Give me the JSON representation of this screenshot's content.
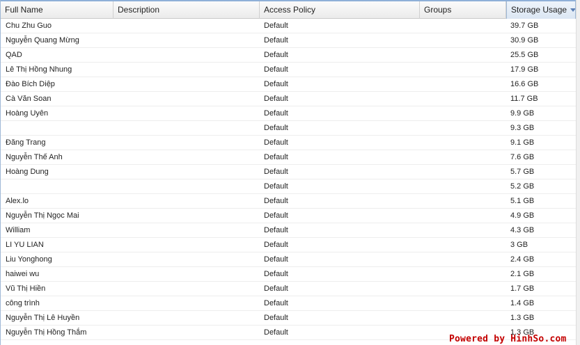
{
  "columns": {
    "full_name": "Full Name",
    "description": "Description",
    "access_policy": "Access Policy",
    "groups": "Groups",
    "storage_usage": "Storage Usage"
  },
  "sort": {
    "column": "storage_usage",
    "direction": "descending",
    "icon": "chevron-down-icon"
  },
  "rows": [
    {
      "name": "Chu Zhu Guo",
      "description": "",
      "policy": "Default",
      "groups": "",
      "usage": "39.7 GB"
    },
    {
      "name": "Nguyễn Quang Mừng",
      "description": "",
      "policy": "Default",
      "groups": "",
      "usage": "30.9 GB"
    },
    {
      "name": "QAD",
      "description": "",
      "policy": "Default",
      "groups": "",
      "usage": "25.5 GB"
    },
    {
      "name": "Lê Thị Hồng Nhung",
      "description": "",
      "policy": "Default",
      "groups": "",
      "usage": "17.9 GB"
    },
    {
      "name": "Đào Bích Diệp",
      "description": "",
      "policy": "Default",
      "groups": "",
      "usage": "16.6 GB"
    },
    {
      "name": "Cà Văn Soan",
      "description": "",
      "policy": "Default",
      "groups": "",
      "usage": "11.7 GB"
    },
    {
      "name": "Hoàng Uyên",
      "description": "",
      "policy": "Default",
      "groups": "",
      "usage": "9.9 GB"
    },
    {
      "name": "",
      "description": "",
      "policy": "Default",
      "groups": "",
      "usage": "9.3 GB"
    },
    {
      "name": "Đăng Trang",
      "description": "",
      "policy": "Default",
      "groups": "",
      "usage": "9.1 GB"
    },
    {
      "name": "Nguyễn Thế Anh",
      "description": "",
      "policy": "Default",
      "groups": "",
      "usage": "7.6 GB"
    },
    {
      "name": "Hoàng Dung",
      "description": "",
      "policy": "Default",
      "groups": "",
      "usage": "5.7 GB"
    },
    {
      "name": "",
      "description": "",
      "policy": "Default",
      "groups": "",
      "usage": "5.2 GB"
    },
    {
      "name": "Alex.lo",
      "description": "",
      "policy": "Default",
      "groups": "",
      "usage": "5.1 GB"
    },
    {
      "name": "Nguyễn Thị Ngọc Mai",
      "description": "",
      "policy": "Default",
      "groups": "",
      "usage": "4.9 GB"
    },
    {
      "name": "William",
      "description": "",
      "policy": "Default",
      "groups": "",
      "usage": "4.3 GB"
    },
    {
      "name": "LI YU LIAN",
      "description": "",
      "policy": "Default",
      "groups": "",
      "usage": "3 GB"
    },
    {
      "name": "Liu Yonghong",
      "description": "",
      "policy": "Default",
      "groups": "",
      "usage": "2.4 GB"
    },
    {
      "name": "haiwei wu",
      "description": "",
      "policy": "Default",
      "groups": "",
      "usage": "2.1 GB"
    },
    {
      "name": "Vũ Thị Hiền",
      "description": "",
      "policy": "Default",
      "groups": "",
      "usage": "1.7 GB"
    },
    {
      "name": "công trình",
      "description": "",
      "policy": "Default",
      "groups": "",
      "usage": "1.4 GB"
    },
    {
      "name": "Nguyễn Thị Lê Huyền",
      "description": "",
      "policy": "Default",
      "groups": "",
      "usage": "1.3 GB"
    },
    {
      "name": "Nguyễn Thị Hồng Thắm",
      "description": "",
      "policy": "Default",
      "groups": "",
      "usage": "1.3 GB"
    }
  ],
  "watermark": "Powered by HinhSo.com",
  "colors": {
    "header_border_accent": "#8fb0d8",
    "sorted_header_bg": "#dbe6f3",
    "watermark": "#c40000"
  }
}
